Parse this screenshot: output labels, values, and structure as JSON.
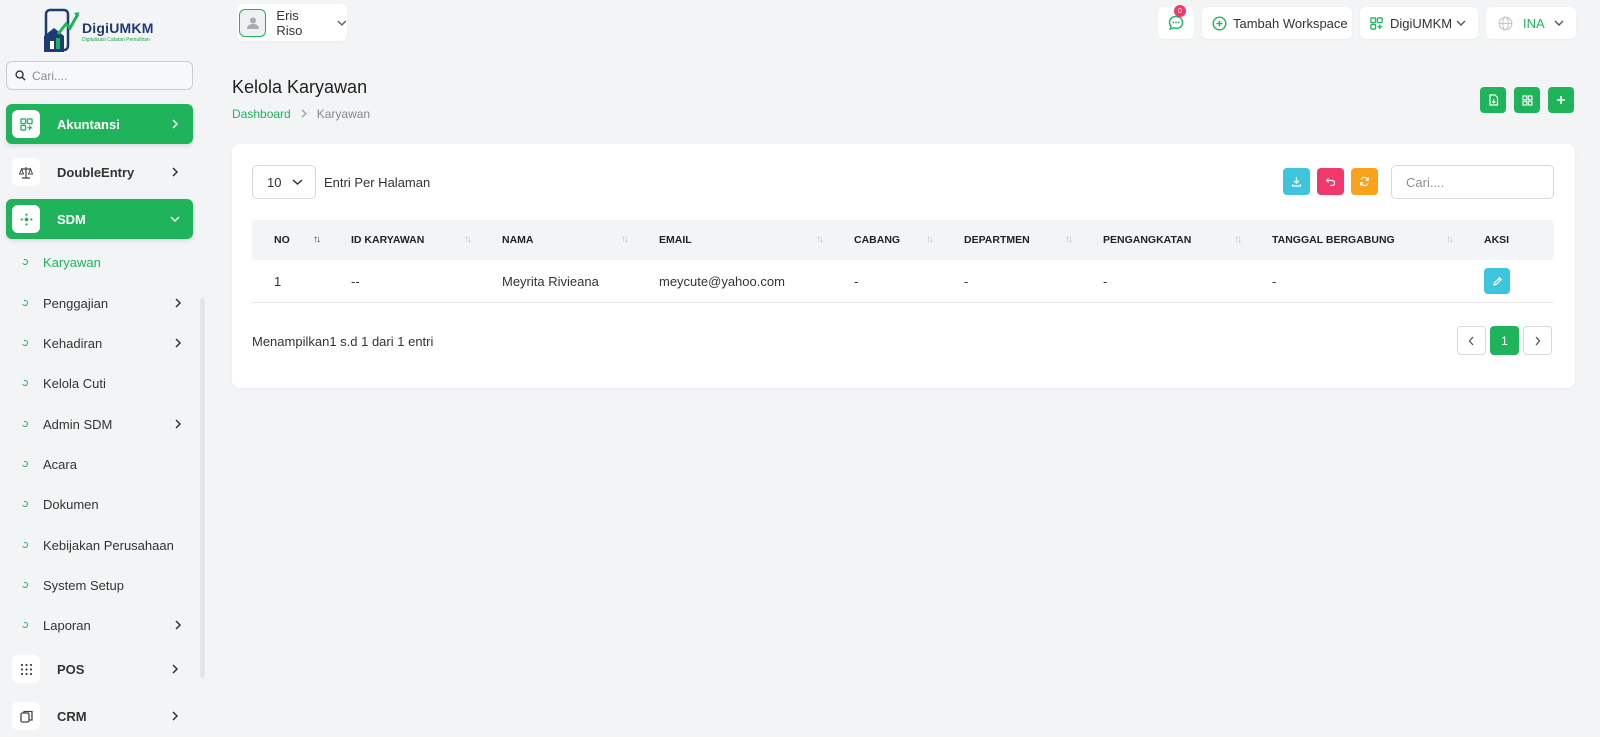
{
  "brand": {
    "name": "DigiUMKM",
    "tagline": "Digitalisasi Catatan Pemulihan",
    "accent": "#1fb35b"
  },
  "sidebar": {
    "search_placeholder": "Cari....",
    "groups": [
      {
        "label": "Akuntansi",
        "icon": "grid-plus-icon",
        "active": true
      },
      {
        "label": "DoubleEntry",
        "icon": "scale-icon",
        "active": false
      },
      {
        "label": "SDM",
        "icon": "hub-icon",
        "active": true,
        "expanded": true
      },
      {
        "label": "POS",
        "icon": "dots-grid-icon",
        "active": false
      },
      {
        "label": "CRM",
        "icon": "copy-icon",
        "active": false
      }
    ],
    "sdm_items": [
      {
        "label": "Karyawan",
        "active": true,
        "has_children": false
      },
      {
        "label": "Penggajian",
        "has_children": true
      },
      {
        "label": "Kehadiran",
        "has_children": true
      },
      {
        "label": "Kelola Cuti",
        "has_children": false
      },
      {
        "label": "Admin SDM",
        "has_children": true
      },
      {
        "label": "Acara",
        "has_children": false
      },
      {
        "label": "Dokumen",
        "has_children": false
      },
      {
        "label": "Kebijakan Perusahaan",
        "has_children": false
      },
      {
        "label": "System Setup",
        "has_children": false
      },
      {
        "label": "Laporan",
        "has_children": true
      }
    ]
  },
  "topbar": {
    "user_name": "Eris Riso",
    "messages_count": "0",
    "add_workspace_label": "Tambah Workspace",
    "workspace_label": "DigiUMKM",
    "language_label": "INA"
  },
  "page": {
    "title": "Kelola Karyawan",
    "breadcrumb": {
      "home": "Dashboard",
      "current": "Karyawan"
    }
  },
  "table_controls": {
    "per_page_value": "10",
    "per_page_label": "Entri Per Halaman",
    "search_placeholder": "Cari...."
  },
  "table": {
    "columns": [
      "NO",
      "ID KARYAWAN",
      "NAMA",
      "EMAIL",
      "CABANG",
      "DEPARTMEN",
      "PENGANGKATAN",
      "TANGGAL BERGABUNG",
      "AKSI"
    ],
    "rows": [
      {
        "no": "1",
        "id": "--",
        "nama": "Meyrita Rivieana",
        "email": "meycute@yahoo.com",
        "cabang": "-",
        "departmen": "-",
        "pengangkatan": "-",
        "tanggal": "-"
      }
    ]
  },
  "footer": {
    "info": "Menampilkan1 s.d 1 dari 1 entri",
    "current_page": "1"
  }
}
